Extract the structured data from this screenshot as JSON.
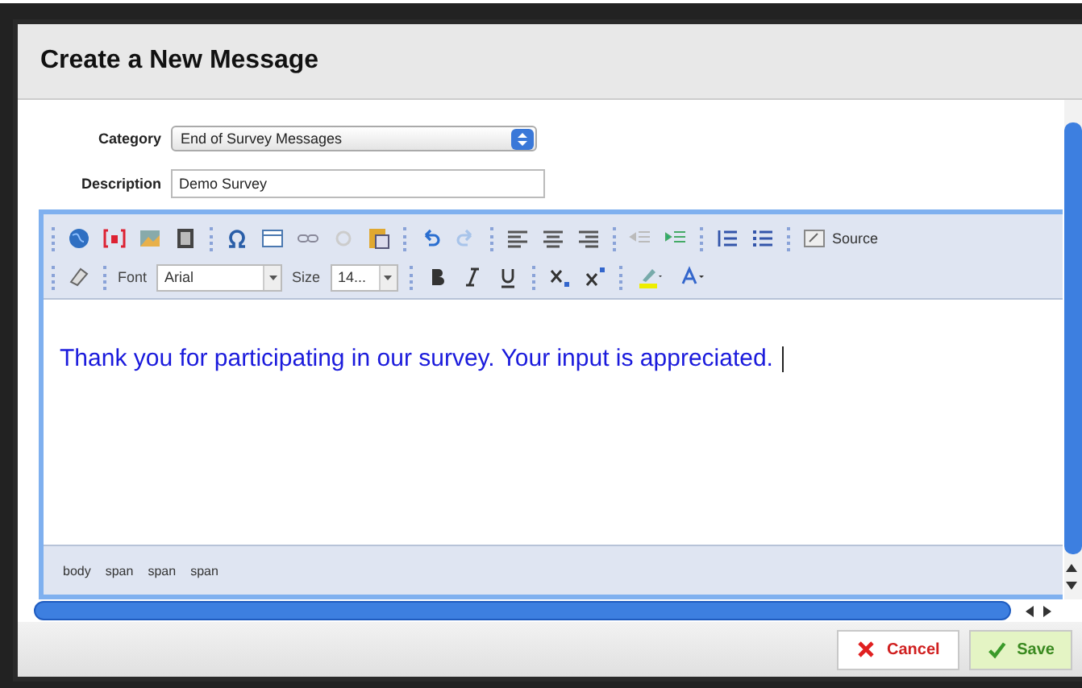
{
  "dialog": {
    "title": "Create a New Message"
  },
  "form": {
    "category": {
      "label": "Category",
      "value": "End of Survey Messages"
    },
    "description": {
      "label": "Description",
      "value": "Demo Survey"
    }
  },
  "editor": {
    "font": {
      "label": "Font",
      "value": "Arial"
    },
    "size": {
      "label": "Size",
      "value": "14..."
    },
    "source_label": "Source",
    "content": "Thank you for participating in our survey. Your input is appreciated.",
    "path": [
      "body",
      "span",
      "span",
      "span"
    ]
  },
  "buttons": [
    {
      "kind": "cancel",
      "label": "Cancel"
    },
    {
      "kind": "save",
      "label": "Save"
    }
  ]
}
